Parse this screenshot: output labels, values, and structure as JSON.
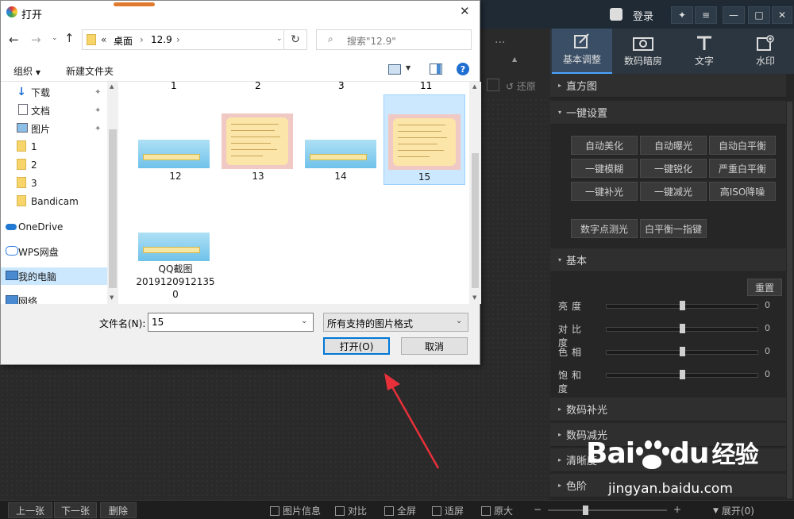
{
  "editor": {
    "title_bar": {
      "login": "登录"
    },
    "tools": [
      {
        "label": "基本调整",
        "icon": "edit-icon"
      },
      {
        "label": "数码暗房",
        "icon": "camera-icon"
      },
      {
        "label": "文字",
        "icon": "text-icon"
      },
      {
        "label": "水印",
        "icon": "watermark-icon"
      }
    ],
    "undo_label": "还原",
    "sections": {
      "histogram": "直方图",
      "one_click": "一键设置",
      "basic": "基本",
      "digital_fill": "数码补光",
      "digital_reduce": "数码减光",
      "sharpness": "清晰度",
      "color_level": "色阶"
    },
    "one_click_buttons": [
      "自动美化",
      "自动曝光",
      "自动白平衡",
      "一键模糊",
      "一键锐化",
      "严重白平衡",
      "一键补光",
      "一键减光",
      "高ISO降噪"
    ],
    "extra_buttons": [
      "数字点测光",
      "白平衡一指键"
    ],
    "reset_label": "重置",
    "sliders": [
      {
        "label": "亮度",
        "value": "0"
      },
      {
        "label": "对比度",
        "value": "0"
      },
      {
        "label": "色相",
        "value": "0"
      },
      {
        "label": "饱和度",
        "value": "0"
      }
    ],
    "bottom": {
      "prev": "上一张",
      "next": "下一张",
      "delete": "删除",
      "info": "图片信息",
      "compare": "对比",
      "fullscreen": "全屏",
      "fit": "适屏",
      "original": "原大",
      "zoom_minus": "−",
      "zoom_plus": "+",
      "expand": "展开(0)"
    },
    "watermark": {
      "brand_a": "Bai",
      "brand_b": "du",
      "brand_c": "经验",
      "url": "jingyan.baidu.com"
    }
  },
  "dialog": {
    "title": "打开",
    "breadcrumb": [
      "桌面",
      "12.9"
    ],
    "breadcrumb_prefix": "«",
    "search_placeholder": "搜索\"12.9\"",
    "organize": "组织",
    "new_folder": "新建文件夹",
    "nav_items": [
      {
        "label": "下载",
        "icon": "download-icon",
        "pinned": true
      },
      {
        "label": "文档",
        "icon": "document-icon",
        "pinned": true
      },
      {
        "label": "图片",
        "icon": "picture-icon",
        "pinned": true
      },
      {
        "label": "1",
        "icon": "folder-icon"
      },
      {
        "label": "2",
        "icon": "folder-icon"
      },
      {
        "label": "3",
        "icon": "folder-icon"
      },
      {
        "label": "Bandicam",
        "icon": "folder-icon"
      },
      {
        "label": "OneDrive",
        "icon": "cloud-icon"
      },
      {
        "label": "WPS网盘",
        "icon": "wps-cloud-icon"
      },
      {
        "label": "我的电脑",
        "icon": "computer-icon"
      },
      {
        "label": "网络",
        "icon": "network-icon"
      }
    ],
    "top_labels": [
      "1",
      "2",
      "3",
      "11"
    ],
    "files": [
      {
        "name": "12",
        "kind": "blue"
      },
      {
        "name": "13",
        "kind": "pink"
      },
      {
        "name": "14",
        "kind": "blue"
      },
      {
        "name": "15",
        "kind": "pink",
        "selected": true
      },
      {
        "name": "QQ截图\n2019120912135\n0",
        "kind": "blue"
      }
    ],
    "filename_label": "文件名(N):",
    "filename_value": "15",
    "filetype": "所有支持的图片格式",
    "open_button": "打开(O)",
    "cancel_button": "取消"
  },
  "colors": {
    "accent": "#4aa3ff",
    "selection": "#cce8ff",
    "arrow": "#e8303a"
  }
}
